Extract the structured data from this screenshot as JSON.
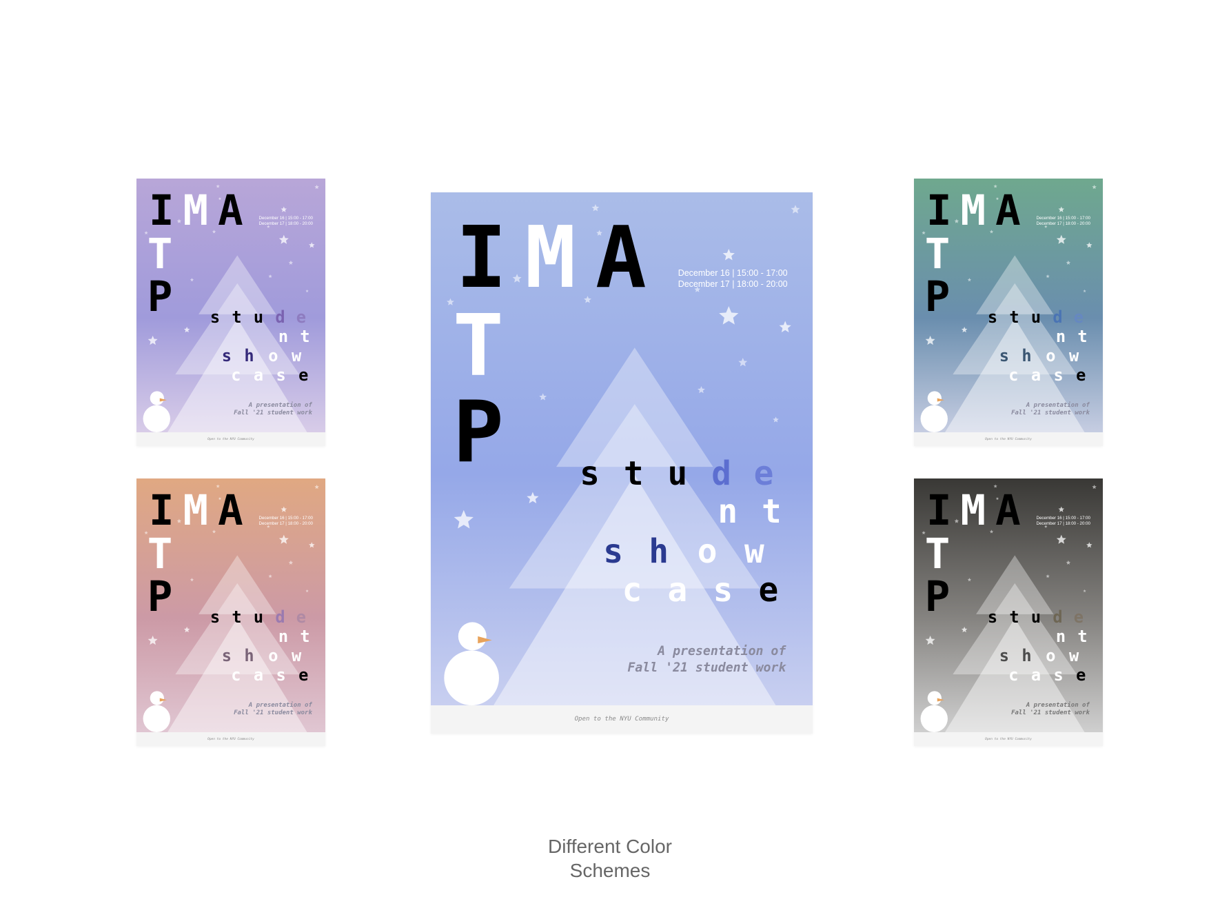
{
  "poster": {
    "letters": [
      "I",
      "M",
      "A",
      "T",
      "P"
    ],
    "dates": [
      "December 16 | 15:00 - 17:00",
      "December 17 | 18:00 - 20:00"
    ],
    "words": {
      "student": [
        "s",
        "t",
        "u",
        "d",
        "e",
        "n",
        "t"
      ],
      "showcase": [
        "s",
        "h",
        "o",
        "w",
        "c",
        "a",
        "s",
        "e"
      ]
    },
    "tagline": [
      "A presentation of",
      "Fall '21 student work"
    ],
    "footer": "Open to the NYU Community"
  },
  "schemes": [
    {
      "id": "purple",
      "top": "#b8a6d8",
      "mid": "#a09bdb",
      "bottom": "#d8cce8",
      "accent_d": "#7a62b0",
      "accent_e": "#8e7cc0",
      "accent_sh": "#352a7a"
    },
    {
      "id": "blue",
      "top": "#aabce8",
      "mid": "#95a8e8",
      "bottom": "#c8cff0",
      "accent_d": "#5c6ed0",
      "accent_e": "#6c7ed8",
      "accent_sh": "#2a3a90"
    },
    {
      "id": "teal",
      "top": "#6fa88e",
      "mid": "#6a8eae",
      "bottom": "#c6cde2",
      "accent_d": "#4a74b4",
      "accent_e": "#6688c0",
      "accent_sh": "#3a5672"
    },
    {
      "id": "peach",
      "top": "#e0a882",
      "mid": "#cc9aa6",
      "bottom": "#e0c6d2",
      "accent_d": "#9a7ab0",
      "accent_e": "#b08aa4",
      "accent_sh": "#7a6478"
    },
    {
      "id": "gray",
      "top": "#393835",
      "mid": "#858380",
      "bottom": "#cfcfcf",
      "accent_d": "#6e6654",
      "accent_e": "#7e7466",
      "accent_sh": "#4c4c4c"
    }
  ],
  "caption": [
    "Different Color",
    "Schemes"
  ]
}
